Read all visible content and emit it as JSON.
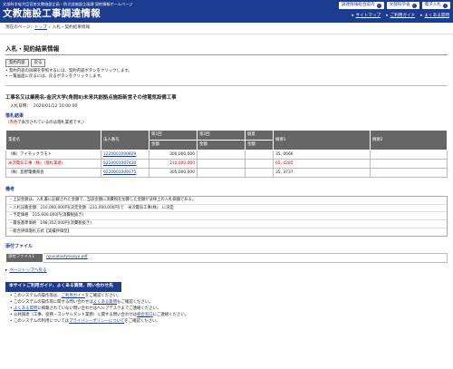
{
  "header": {
    "subtitle": "文部科学省大臣官房文教施設企画・防災部施設企画課 契約情報ホームページ",
    "title": "文教施設工事調達情報",
    "buttons": [
      "調達情報総合案内",
      "文部科学省",
      "電子入札"
    ],
    "links": [
      "サイトマップ",
      "ご利用ガイド",
      "よくある質問"
    ]
  },
  "breadcrumb": {
    "label": "現在のページ：",
    "home": "トップ",
    "current": "入札・契約結果情報"
  },
  "page_title": "入札・契約結果情報",
  "buttons": {
    "contract": "契約内容",
    "back": "戻る"
  },
  "notes": [
    "契約内容の詳細を参照するには、契約内容ボタンをクリックします。",
    "一覧画面に戻るには、戻るボタンをクリックします。"
  ],
  "contract_title": "工事名又は業務名‐金沢大学(角間Ⅱ)未来共創拠点施設新営その他電気設備工事",
  "bid_date": {
    "label": "入札日時：",
    "value": "2024/01/12 10:00:00"
  },
  "result_section": "落札結果",
  "result_note": {
    "red": "（赤色",
    "rest": "で表示されているのは落札業者です。）"
  },
  "table": {
    "headers": [
      "業者名",
      "法人番号",
      "第1回",
      "第2回",
      "随意",
      "摘要1",
      "摘要2"
    ],
    "subheaders": [
      "金額",
      "金額",
      "金額"
    ],
    "rows": [
      {
        "name": "（株）アイチックラモト",
        "corp": "1220001000829",
        "r1": "300,000,000",
        "r2": "",
        "zuii": "",
        "memo1": "35, 0666",
        "memo2": "",
        "winner": false
      },
      {
        "name": "米沢電気工事（株）(落札業者)",
        "corp": "5220001007430",
        "r1": "210,000,000",
        "r2": "",
        "zuii": "",
        "memo1": "65, 4285",
        "memo2": "",
        "winner": true
      },
      {
        "name": "（株）島野電機商会",
        "corp": "9220001009175",
        "r1": "305,000,000",
        "r2": "",
        "zuii": "",
        "memo1": "35, 3737",
        "memo2": "",
        "winner": false
      }
    ]
  },
  "remarks_section": "備考",
  "remarks": [
    "・上記金額は、入札書に記載された金額で、当該金額に消費税を加算した金額が法律上の入札価額である。",
    "・入札記載金額　210,000,000円(決定金額　231,000,000円)で　米沢電気工事(株)　に決定",
    "・予定価格　215,600,000円(消費税抜き)",
    "・最低基準価格　198,352,000円(消費税抜き)",
    "・総合評価落札方式【実績評価型】"
  ],
  "attachment_section": "添付ファイル",
  "attachment": {
    "label": "添付ファイル1",
    "file": "nyusatsutyousyo.pdf"
  },
  "page_top": "ページトップへ戻る",
  "help": {
    "title": "本サイトご利用ガイド、よくある質問、問い合わせ先",
    "items": [
      {
        "pre": "このシステムの操作等は、",
        "link": "ご利用ガイド",
        "post": "をご確認ください。"
      },
      {
        "pre": "このシステムの操作等に関する問い合わせは",
        "link": "よくある質問",
        "post": "もご確認ください。"
      },
      {
        "pre": "",
        "link": "よくある質問",
        "post": "に掲載されていない問い合わせはヘルプデスクまでご連絡ください。"
      },
      {
        "pre": "公共調達（工事、役務・コンサルタント業務）に関する問い合わせは",
        "link": "総合窓口",
        "post": "にご連絡ください。"
      },
      {
        "pre": "このシステムの利用については",
        "link": "プライバシーポリシーについて",
        "post": "をご確認ください。"
      }
    ]
  }
}
